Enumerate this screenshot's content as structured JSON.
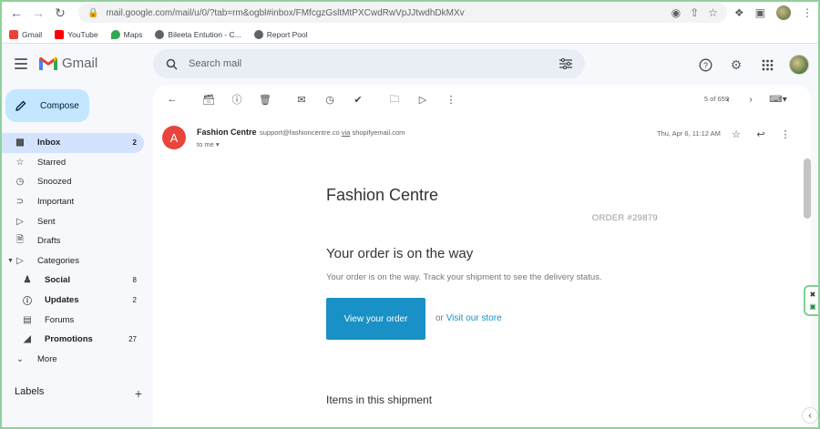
{
  "browser": {
    "url": "mail.google.com/mail/u/0/?tab=rm&ogbl#inbox/FMfcgzGsltMtPXCwdRwVpJJtwdhDkMXv",
    "bookmarks": [
      {
        "label": "Gmail",
        "icon": "gmail-icon",
        "color": "#ea4335"
      },
      {
        "label": "YouTube",
        "icon": "youtube-icon",
        "color": "#ff0000"
      },
      {
        "label": "Maps",
        "icon": "maps-icon",
        "color": "#34a853"
      },
      {
        "label": "Bileeta Entution - C...",
        "icon": "globe-icon",
        "color": "#5f6368"
      },
      {
        "label": "Report Pool",
        "icon": "globe-icon",
        "color": "#5f6368"
      }
    ]
  },
  "header": {
    "app_name": "Gmail",
    "search_placeholder": "Search mail"
  },
  "compose": {
    "label": "Compose"
  },
  "sidebar": {
    "items": [
      {
        "label": "Inbox",
        "count": "2",
        "icon": "inbox-icon",
        "active": true
      },
      {
        "label": "Starred",
        "count": "",
        "icon": "star-icon"
      },
      {
        "label": "Snoozed",
        "count": "",
        "icon": "clock-icon"
      },
      {
        "label": "Important",
        "count": "",
        "icon": "important-icon"
      },
      {
        "label": "Sent",
        "count": "",
        "icon": "send-icon"
      },
      {
        "label": "Drafts",
        "count": "",
        "icon": "draft-icon"
      },
      {
        "label": "Categories",
        "count": "",
        "icon": "label-icon"
      },
      {
        "label": "Social",
        "count": "8",
        "icon": "people-icon"
      },
      {
        "label": "Updates",
        "count": "2",
        "icon": "info-icon"
      },
      {
        "label": "Forums",
        "count": "",
        "icon": "forum-icon"
      },
      {
        "label": "Promotions",
        "count": "27",
        "icon": "tag-icon"
      },
      {
        "label": "More",
        "count": "",
        "icon": "chevron-down-icon"
      }
    ],
    "labels_title": "Labels"
  },
  "toolbar": {
    "pager": "5 of 659"
  },
  "message": {
    "avatar_letter": "A",
    "sender_name": "Fashion Centre",
    "sender_email": "support@fashioncentre.co",
    "via_label": "via",
    "via_domain": "shopifyemail.com",
    "to": "to me",
    "date": "Thu, Apr 6, 11:12 AM"
  },
  "email": {
    "brand": "Fashion Centre",
    "order_number": "ORDER #29879",
    "headline": "Your order is on the way",
    "subline": "Your order is on the way. Track your shipment to see the delivery status.",
    "cta_label": "View your order",
    "or_text": "or",
    "visit_link": "Visit our store",
    "items_title": "Items in this shipment"
  },
  "colors": {
    "accent": "#1990c6",
    "compose_bg": "#c2e7ff",
    "active_item_bg": "#d3e3fd",
    "avatar_bg": "#e8453c"
  }
}
